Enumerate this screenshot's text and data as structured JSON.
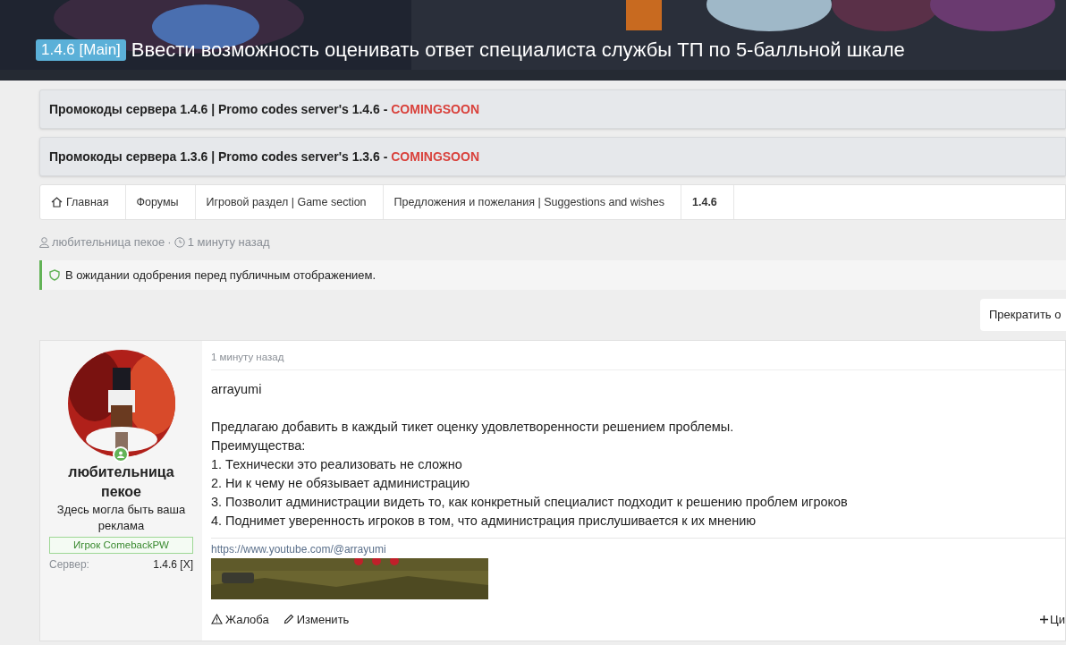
{
  "header": {
    "prefix": "1.4.6 [Main]",
    "title": "Ввести возможность оценивать ответ специалиста службы ТП по 5-балльной шкале"
  },
  "notices": [
    {
      "text": "Промокоды сервера 1.4.6 | Promo codes server's 1.4.6 - ",
      "status": "COMINGSOON"
    },
    {
      "text": "Промокоды сервера 1.3.6 | Promo codes server's 1.3.6 - ",
      "status": "COMINGSOON"
    }
  ],
  "breadcrumbs": [
    {
      "label": "Главная",
      "kind": "home",
      "selected": false
    },
    {
      "label": "Форумы",
      "kind": "link",
      "selected": false
    },
    {
      "label": "Игровой раздел | Game section",
      "kind": "link",
      "selected": false
    },
    {
      "label": "Предложения и пожелания | Suggestions and wishes",
      "kind": "link",
      "selected": false
    },
    {
      "label": "1.4.6",
      "kind": "link",
      "selected": true
    }
  ],
  "meta": {
    "author": "любительница пекое",
    "separator": "·",
    "time": "1 минуту назад"
  },
  "approval_notice": "В ожидании одобрения перед публичным отображением.",
  "watch_button": "Прекратить о",
  "post": {
    "user": {
      "online": true,
      "name": "любительница пекое",
      "title": "Здесь могла быть ваша реклама",
      "banner": "Игрок ComebackPW",
      "server_label": "Сервер:",
      "server_value": "1.4.6 [X]"
    },
    "time": "1 минуту назад",
    "greeting": "arrayumi",
    "lines": [
      "Предлагаю добавить в каждый тикет оценку удовлетворенности решением проблемы.",
      "Преимущества:",
      "1. Технически это реализовать не сложно",
      "2. Ни к чему не обязывает администрацию",
      "3. Позволит администрации видеть то, как конкретный специалист подходит к решению проблем игроков",
      "4. Поднимет уверенность игроков в том, что администрация прислушивается к их мнению"
    ],
    "signature_link": "https://www.youtube.com/@arrayumi",
    "actions": [
      {
        "label": "Жалоба",
        "kind": "report"
      },
      {
        "label": "Изменить",
        "kind": "edit"
      }
    ],
    "quote_action": "Ци"
  }
}
